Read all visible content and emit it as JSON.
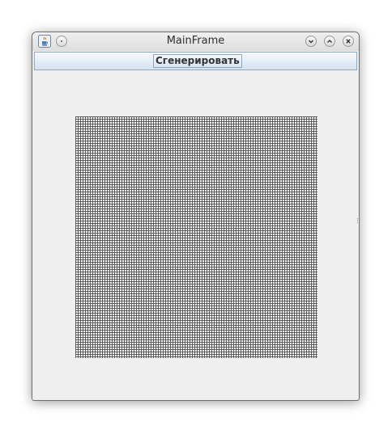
{
  "window": {
    "title": "MainFrame",
    "icons": {
      "app": "java-cup-icon",
      "menu": "window-menu-icon",
      "minimize": "chevron-down-icon",
      "maximize": "chevron-up-icon",
      "close": "close-icon"
    }
  },
  "toolbar": {
    "generate_label": "Сгенерировать"
  },
  "canvas": {
    "content": "grid"
  },
  "colors": {
    "window_bg": "#efefef",
    "toolbar_bg": "#e4edf7",
    "grid_line": "#5a5a5a",
    "grid_bg": "#ffffff"
  }
}
